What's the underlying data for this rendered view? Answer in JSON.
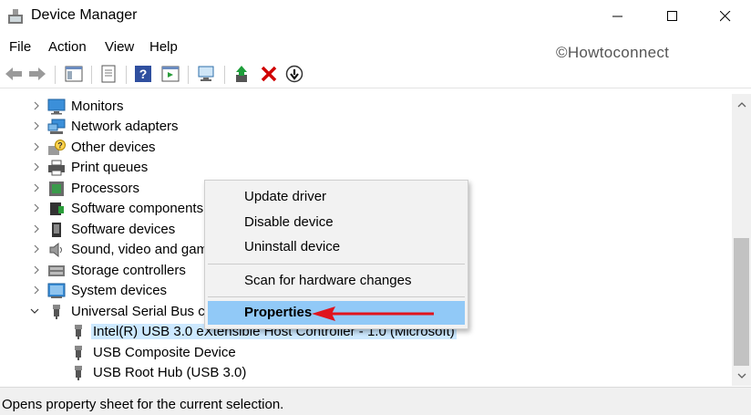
{
  "window": {
    "title": "Device Manager",
    "controls": [
      "minimize-icon",
      "maximize-icon",
      "close-icon"
    ]
  },
  "menubar": {
    "file": "File",
    "action": "Action",
    "view": "View",
    "help": "Help"
  },
  "watermark": "©Howtoconnect",
  "toolbar": {
    "buttons": [
      "back-icon",
      "forward-icon",
      "show-hide-console-tree-icon",
      "properties-icon",
      "help-icon",
      "action-pane-icon",
      "scan-hardware-icon",
      "update-driver-icon",
      "uninstall-icon",
      "disable-icon"
    ]
  },
  "tree": {
    "categories": [
      {
        "label": "Monitors",
        "icon": "monitor-icon"
      },
      {
        "label": "Network adapters",
        "icon": "network-adapter-icon"
      },
      {
        "label": "Other devices",
        "icon": "unknown-device-icon"
      },
      {
        "label": "Print queues",
        "icon": "printer-icon"
      },
      {
        "label": "Processors",
        "icon": "processor-icon"
      },
      {
        "label": "Software components",
        "icon": "software-component-icon"
      },
      {
        "label": "Software devices",
        "icon": "software-device-icon"
      },
      {
        "label": "Sound, video and gam",
        "icon": "speaker-icon"
      },
      {
        "label": "Storage controllers",
        "icon": "storage-controller-icon"
      },
      {
        "label": "System devices",
        "icon": "system-device-icon"
      },
      {
        "label": "Universal Serial Bus co",
        "icon": "usb-icon",
        "expanded": true
      }
    ],
    "usb_children": [
      {
        "label": "Intel(R) USB 3.0 eXtensible Host Controller - 1.0 (Microsoft)",
        "selected": true
      },
      {
        "label": "USB Composite Device"
      },
      {
        "label": "USB Root Hub (USB 3.0)"
      }
    ]
  },
  "context_menu": {
    "update_driver": "Update driver",
    "disable_device": "Disable device",
    "uninstall_device": "Uninstall device",
    "scan": "Scan for hardware changes",
    "properties": "Properties",
    "highlighted": "Properties"
  },
  "status": "Opens property sheet for the current selection.",
  "colors": {
    "selection": "#cce8ff",
    "menu_highlight": "#91c9f7",
    "annotation_arrow": "#e0141e",
    "delete_red": "#d00000",
    "green_arrow": "#1e9e3a"
  }
}
